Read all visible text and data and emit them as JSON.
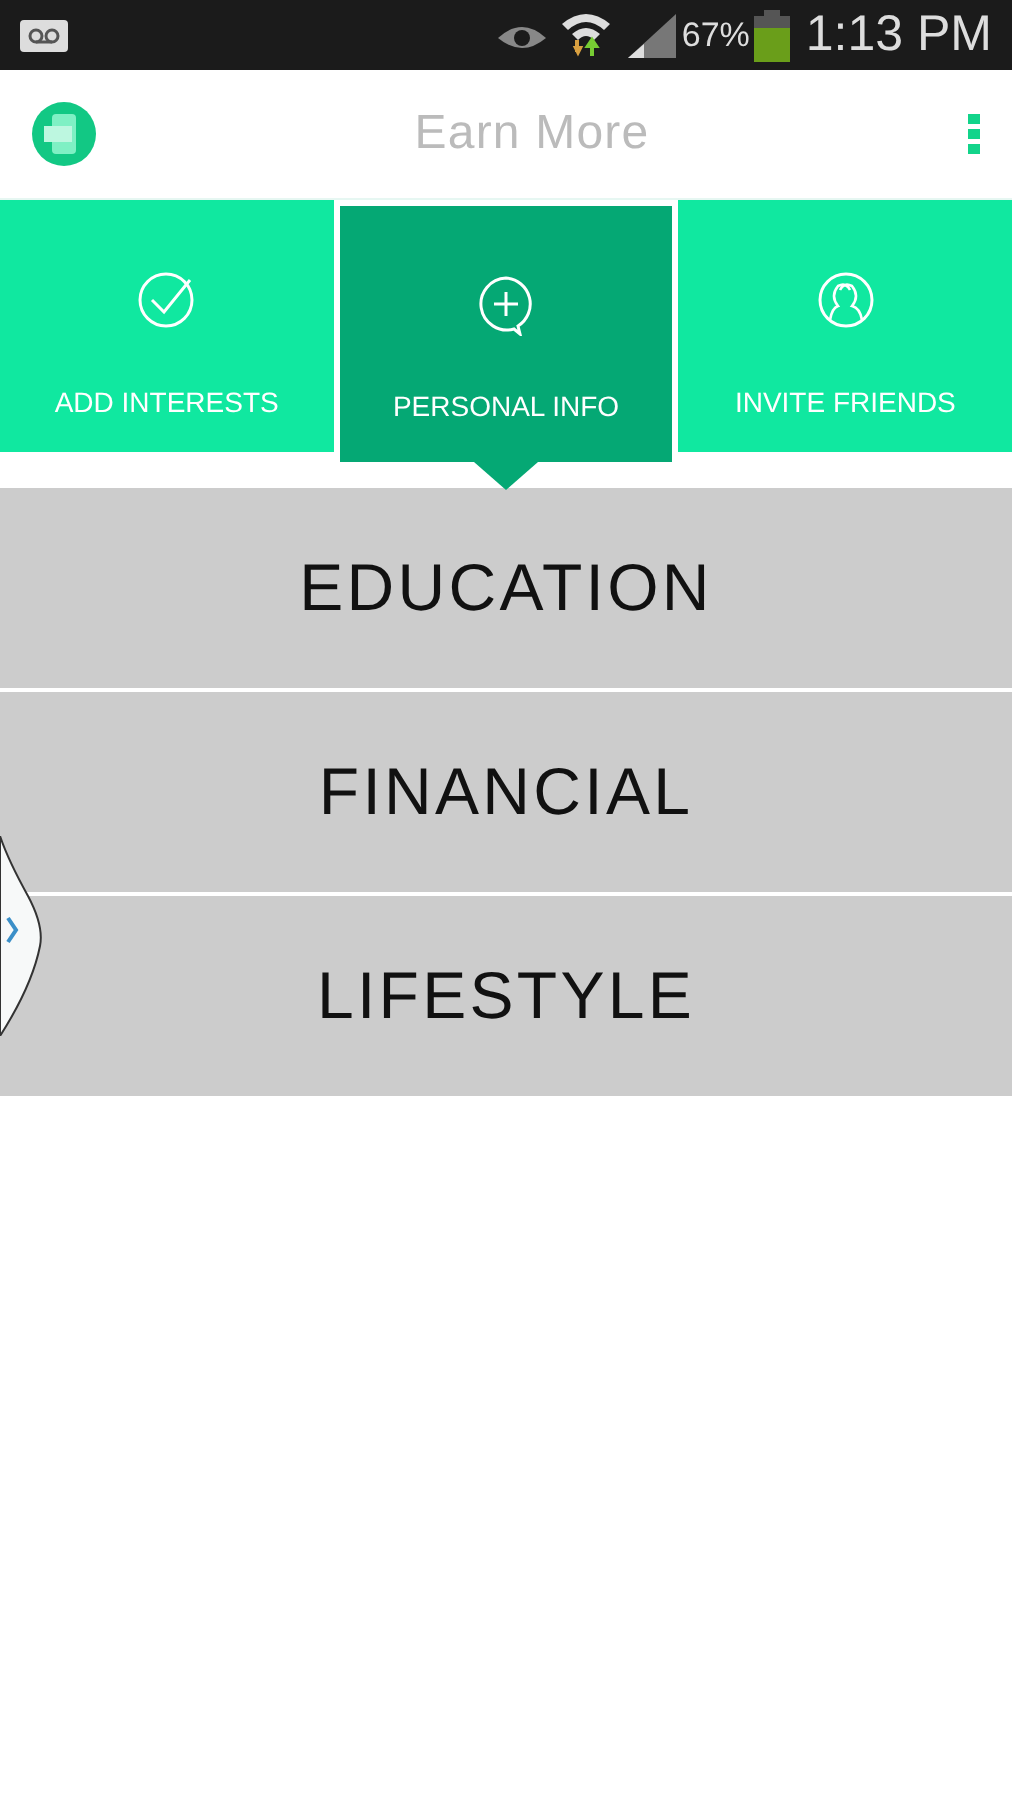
{
  "status_bar": {
    "battery": "67%",
    "time": "1:13 PM"
  },
  "app_bar": {
    "title": "Earn More"
  },
  "tabs": [
    {
      "label": "ADD INTERESTS",
      "kind": "check",
      "selected": false
    },
    {
      "label": "PERSONAL INFO",
      "kind": "plus",
      "selected": true
    },
    {
      "label": "INVITE FRIENDS",
      "kind": "people",
      "selected": false
    }
  ],
  "categories": [
    {
      "label": "EDUCATION"
    },
    {
      "label": "FINANCIAL"
    },
    {
      "label": "LIFESTYLE"
    }
  ]
}
